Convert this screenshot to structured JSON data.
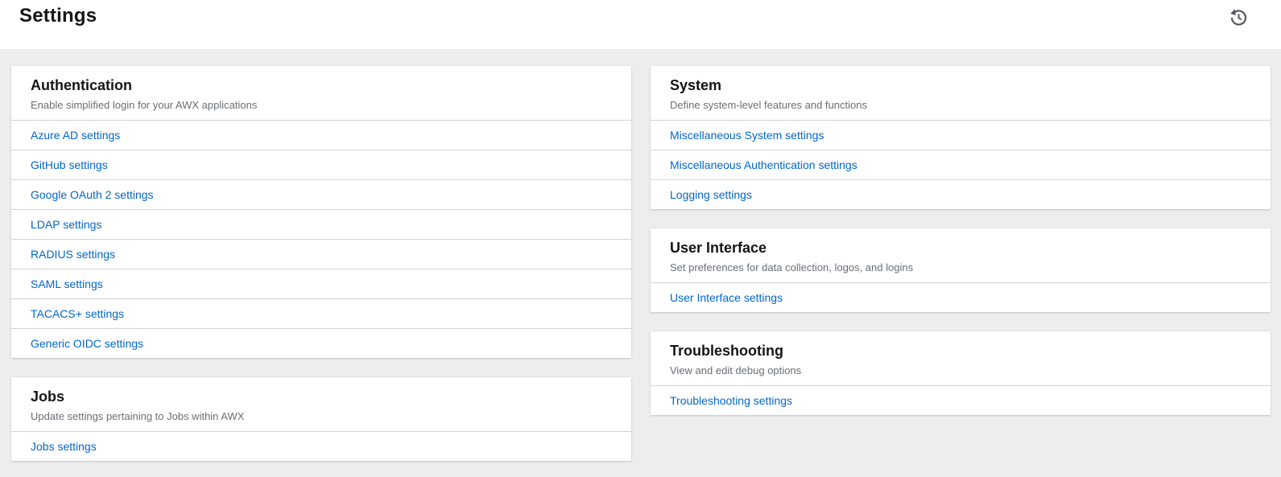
{
  "header": {
    "title": "Settings",
    "history_icon": "history-icon"
  },
  "cards": [
    {
      "id": "authentication",
      "column": "left",
      "title": "Authentication",
      "description": "Enable simplified login for your AWX applications",
      "links": [
        "Azure AD settings",
        "GitHub settings",
        "Google OAuth 2 settings",
        "LDAP settings",
        "RADIUS settings",
        "SAML settings",
        "TACACS+ settings",
        "Generic OIDC settings"
      ]
    },
    {
      "id": "jobs",
      "column": "left",
      "title": "Jobs",
      "description": "Update settings pertaining to Jobs within AWX",
      "links": [
        "Jobs settings"
      ]
    },
    {
      "id": "system",
      "column": "right",
      "title": "System",
      "description": "Define system-level features and functions",
      "links": [
        "Miscellaneous System settings",
        "Miscellaneous Authentication settings",
        "Logging settings"
      ]
    },
    {
      "id": "user-interface",
      "column": "right",
      "title": "User Interface",
      "description": "Set preferences for data collection, logos, and logins",
      "links": [
        "User Interface settings"
      ]
    },
    {
      "id": "troubleshooting",
      "column": "right",
      "title": "Troubleshooting",
      "description": "View and edit debug options",
      "links": [
        "Troubleshooting settings"
      ]
    }
  ],
  "colors": {
    "link": "#0066cc",
    "page_background": "#ededed",
    "card_background": "#ffffff",
    "heading_text": "#151515",
    "description_text": "#6a6e73",
    "divider": "#d2d2d2",
    "icon": "#55585c"
  }
}
